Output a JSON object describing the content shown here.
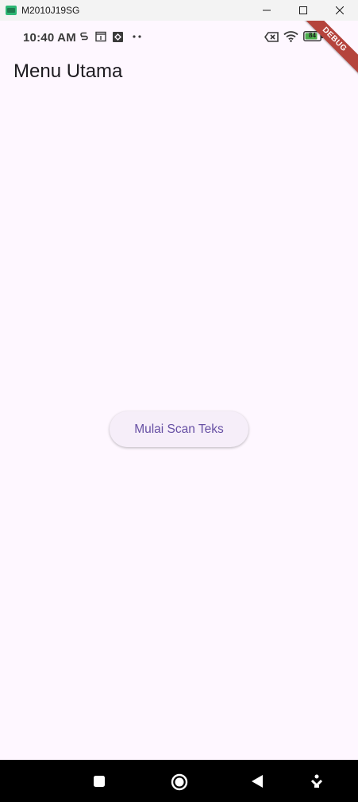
{
  "window": {
    "title": "M2010J19SG",
    "icons": [
      "app-icon",
      "minimize-icon",
      "maximize-icon",
      "close-icon"
    ]
  },
  "status_bar": {
    "time": "10:40 AM",
    "battery_level": "84",
    "icons": [
      "s-icon",
      "calendar-icon",
      "diamond-icon",
      "more-dots-icon",
      "no-sim-icon",
      "wifi-icon",
      "battery-icon"
    ]
  },
  "debug_banner": "DEBUG",
  "app_bar": {
    "title": "Menu Utama"
  },
  "main": {
    "scan_button_label": "Mulai Scan Teks"
  },
  "nav_bar": {
    "icons": [
      "recents-square-icon",
      "home-circle-icon",
      "back-triangle-icon",
      "keyboard-down-icon"
    ]
  },
  "colors": {
    "background": "#fef7ff",
    "button_text": "#6750a4",
    "debug_ribbon": "#b5443c"
  }
}
